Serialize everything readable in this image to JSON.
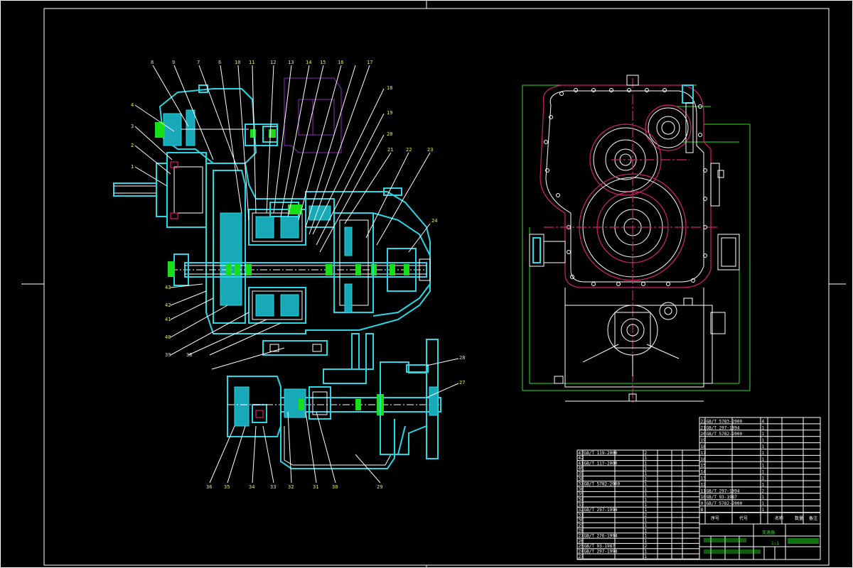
{
  "drawing": {
    "section_view": {
      "top_callouts": [
        "8",
        "9",
        "7",
        "6",
        "10",
        "11",
        "12",
        "13",
        "14",
        "15",
        "16",
        "17"
      ],
      "right_callouts": [
        "18",
        "19",
        "20",
        "21",
        "22",
        "23",
        "24",
        "25",
        "26",
        "27"
      ],
      "left_callouts": [
        "4",
        "3",
        "2",
        "1"
      ],
      "lower_left_callouts": [
        "43",
        "42",
        "41",
        "40",
        "39",
        "38"
      ],
      "bottom_callouts": [
        "36",
        "35",
        "34",
        "33",
        "32",
        "31",
        "30",
        "29",
        "28"
      ],
      "right_lower_callouts": [
        "28",
        "27"
      ]
    },
    "bom_left": {
      "rows": [
        [
          "43",
          "GB/T 119-2000",
          "",
          "2",
          ""
        ],
        [
          "42",
          "",
          "",
          "1",
          ""
        ],
        [
          "41",
          "GB/T 117-2000",
          "",
          "1",
          ""
        ],
        [
          "40",
          "",
          "",
          "1",
          ""
        ],
        [
          "39",
          "",
          "",
          "1",
          ""
        ],
        [
          "38",
          "",
          "",
          "1",
          ""
        ],
        [
          "37",
          "GB/T 5782-2000",
          "",
          "1",
          ""
        ],
        [
          "36",
          "",
          "",
          "1",
          ""
        ],
        [
          "35",
          "",
          "",
          "1",
          ""
        ],
        [
          "34",
          "",
          "",
          "1",
          ""
        ],
        [
          "33",
          "",
          "",
          "1",
          ""
        ],
        [
          "32",
          "GB/T 297-1994",
          "",
          "1",
          ""
        ],
        [
          "31",
          "",
          "",
          "2",
          ""
        ],
        [
          "30",
          "",
          "",
          "1",
          ""
        ],
        [
          "29",
          "",
          "",
          "1",
          ""
        ],
        [
          "28",
          "",
          "",
          "1",
          ""
        ],
        [
          "27",
          "GB/T 276-1994",
          "",
          "1",
          ""
        ],
        [
          "26",
          "",
          "",
          "1",
          ""
        ],
        [
          "25",
          "GB/T 93-1987",
          "",
          "2",
          ""
        ],
        [
          "24",
          "GB/T 297-1994",
          "",
          "1",
          ""
        ],
        [
          "23",
          "",
          "",
          "1",
          ""
        ]
      ]
    },
    "bom_right": {
      "rows": [
        [
          "22",
          "GB/T 5783-2000",
          "",
          "4",
          ""
        ],
        [
          "21",
          "GB/T 297-1994",
          "",
          "1",
          ""
        ],
        [
          "20",
          "GB/T 5782-2000",
          "",
          "1",
          ""
        ],
        [
          "19",
          "",
          "",
          "1",
          ""
        ],
        [
          "18",
          "",
          "",
          "1",
          ""
        ],
        [
          "17",
          "",
          "",
          "1",
          ""
        ],
        [
          "16",
          "",
          "",
          "1",
          ""
        ],
        [
          "15",
          "",
          "",
          "1",
          ""
        ],
        [
          "14",
          "",
          "",
          "1",
          ""
        ],
        [
          "13",
          "",
          "",
          "1",
          ""
        ],
        [
          "12",
          "",
          "",
          "1",
          ""
        ],
        [
          "11",
          "GB/T 297-1994",
          "",
          "2",
          ""
        ],
        [
          "10",
          "GB/T 93-1987",
          "",
          "1",
          ""
        ],
        [
          "9",
          "GB/T 5782-2000",
          "",
          "1",
          ""
        ],
        [
          "8",
          "",
          "",
          "1",
          ""
        ]
      ]
    },
    "title_block": {
      "header": [
        "序号",
        "代号",
        "名称",
        "数量",
        "备注"
      ],
      "drawing_name": "变速器",
      "scale_label": "1:1"
    }
  }
}
